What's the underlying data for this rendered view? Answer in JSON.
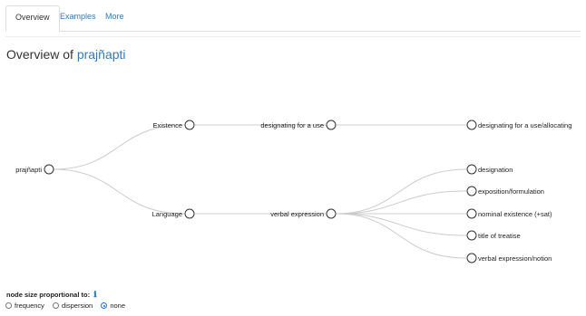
{
  "tabs": [
    {
      "label": "Overview",
      "active": true
    },
    {
      "label": "Examples",
      "active": false
    },
    {
      "label": "More",
      "active": false
    }
  ],
  "title": {
    "prefix": "Overview of",
    "lemma": "prajñapti"
  },
  "tree": {
    "root": "prajñapti",
    "level1": [
      "Existence",
      "Language"
    ],
    "level2": [
      "designating for a use",
      "verbal expression"
    ],
    "level3": [
      "designating for a use/allocating",
      "designation",
      "exposition/formulation",
      "nominal existence (+sat)",
      "title of treatise",
      "verbal expression/notion"
    ]
  },
  "options": {
    "label": "node size proportional to:",
    "info_icon": "info-icon",
    "radios": [
      {
        "label": "frequency",
        "checked": false
      },
      {
        "label": "dispersion",
        "checked": false
      },
      {
        "label": "none",
        "checked": true
      }
    ]
  },
  "colors": {
    "link": "#337ab7",
    "edge": "#cccccc",
    "radio_checked": "#1a73e8"
  }
}
